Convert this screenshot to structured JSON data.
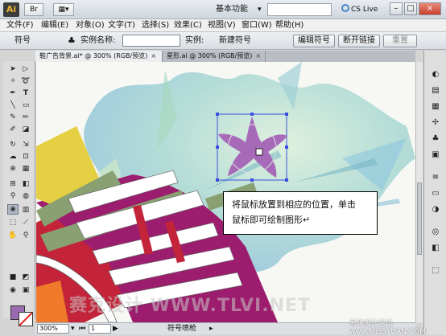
{
  "titlebar": {
    "app_icon": "Ai",
    "workspace": "基本功能",
    "cslive": "CS Live",
    "minimize_glyph": "–",
    "maximize_glyph": "□",
    "close_glyph": "×",
    "layout_button_glyph": "▦▾",
    "bridge_button_glyph": "Br"
  },
  "menubar": {
    "items": [
      "文件(F)",
      "编辑(E)",
      "对象(O)",
      "文字(T)",
      "选择(S)",
      "效果(C)",
      "视图(V)",
      "窗口(W)",
      "帮助(H)"
    ]
  },
  "control_bar": {
    "label_symbol": "符号",
    "label_instance_name": "实例名称:",
    "instance_name_value": "",
    "label_instance": "实例:",
    "instance_value": "新建符号",
    "edit_symbol_button": "编辑符号",
    "break_link_button": "断开链接",
    "reset_button": "重置"
  },
  "tabs": [
    {
      "label": "鞋广告背景.ai* @ 300% (RGB/预览)",
      "close": "×"
    },
    {
      "label": "星形.ai @ 300% (RGB/预览)",
      "close": "×"
    }
  ],
  "callout": {
    "line1": "将鼠标放置到相应的位置，单击",
    "line2": "鼠标即可绘制图形↵"
  },
  "watermark": "赛克设计 WWW.TLVI.NET",
  "credit": "思缘设计论坛  www.MISSYUAN.COM",
  "status": {
    "zoom": "300%",
    "page": "1",
    "tool_name": "符号喷枪"
  },
  "colors": {
    "fill_swatch": "#9b6bb2",
    "star_fill": "#a76ab8",
    "selection_blue": "#3a4ee0",
    "shoe_magenta": "#9c1d6e",
    "shoe_yellow": "#e5cf43",
    "shoe_olive": "#88a072",
    "splash_teal": "#8fcbc9"
  },
  "icons": {
    "tools": [
      "selection-arrow-icon",
      "direct-selection-icon",
      "magic-wand-icon",
      "lasso-icon",
      "pen-icon",
      "type-icon",
      "line-icon",
      "rectangle-icon",
      "paintbrush-icon",
      "pencil-icon",
      "blob-brush-icon",
      "eraser-icon",
      "rotate-icon",
      "scale-icon",
      "warp-icon",
      "free-transform-icon",
      "shape-builder-icon",
      "perspective-icon",
      "mesh-icon",
      "gradient-icon",
      "eyedropper-icon",
      "blend-icon",
      "symbol-sprayer-icon",
      "column-graph-icon",
      "artboard-icon",
      "slice-icon",
      "hand-icon",
      "zoom-icon"
    ],
    "right_panel": [
      "color-panel-icon",
      "color-guide-icon",
      "swatches-icon",
      "brushes-icon",
      "symbols-icon",
      "graphic-styles-icon",
      "stroke-icon",
      "gradient-panel-icon",
      "transparency-icon",
      "appearance-icon",
      "layers-icon",
      "links-icon"
    ]
  }
}
